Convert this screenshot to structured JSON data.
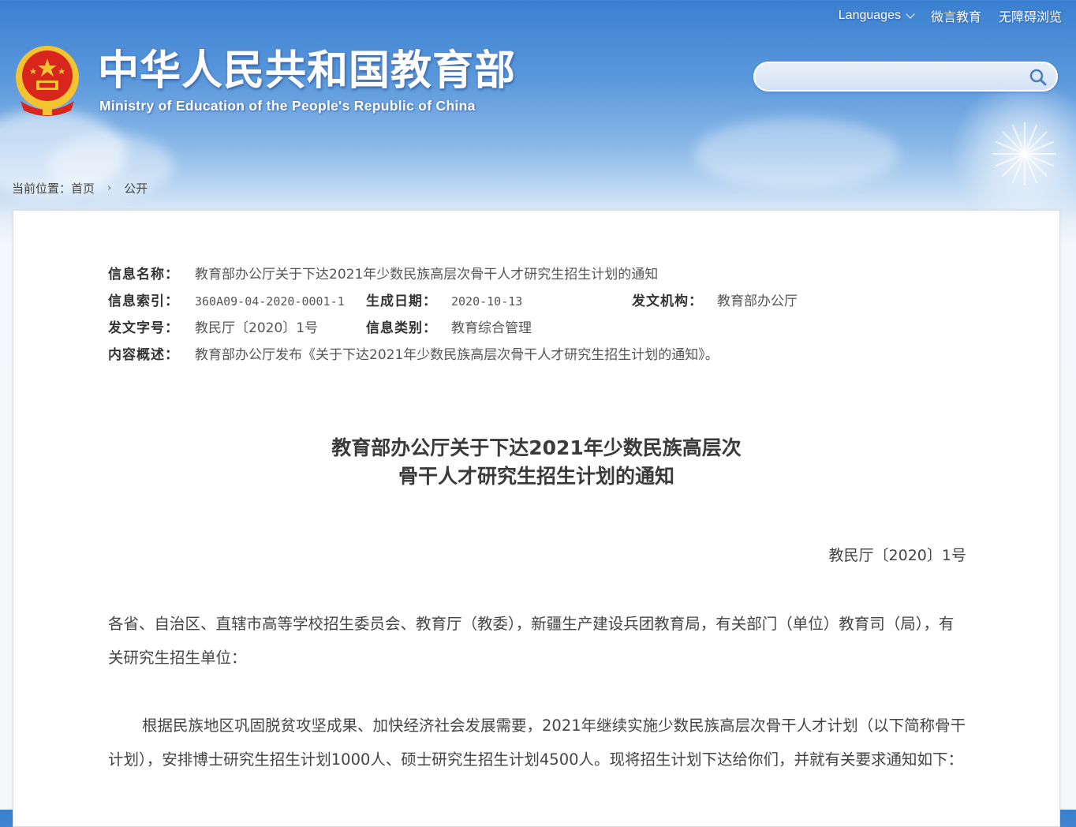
{
  "header": {
    "title": "中华人民共和国教育部",
    "subtitle": "Ministry of Education of the People's Republic of China",
    "top_links": [
      "Languages",
      "微言教育",
      "无障碍浏览"
    ],
    "search": {
      "placeholder": "",
      "value": ""
    }
  },
  "breadcrumb": {
    "prefix": "当前位置：",
    "items": [
      "首页",
      "公开"
    ]
  },
  "metadata": {
    "name_label": "信息名称：",
    "name_value": "教育部办公厅关于下达2021年少数民族高层次骨干人才研究生招生计划的通知",
    "index_label": "信息索引：",
    "index_value": "360A09-04-2020-0001-1",
    "date_label": "生成日期：",
    "date_value": "2020-10-13",
    "org_label": "发文机构：",
    "org_value": "教育部办公厅",
    "docno_label": "发文字号：",
    "docno_value": "教民厅〔2020〕1号",
    "category_label": "信息类别：",
    "category_value": "教育综合管理",
    "summary_label": "内容概述：",
    "summary_value": "教育部办公厅发布《关于下达2021年少数民族高层次骨干人才研究生招生计划的通知》。"
  },
  "document": {
    "title_line1": "教育部办公厅关于下达2021年少数民族高层次",
    "title_line2": "骨干人才研究生招生计划的通知",
    "number": "教民厅〔2020〕1号",
    "addressee": "各省、自治区、直辖市高等学校招生委员会、教育厅（教委），新疆生产建设兵团教育局，有关部门（单位）教育司（局），有关研究生招生单位：",
    "body_p1": "根据民族地区巩固脱贫攻坚成果、加快经济社会发展需要，2021年继续实施少数民族高层次骨干人才计划（以下简称骨干计划），安排博士研究生招生计划1000人、硕士研究生招生计划4500人。现将招生计划下达给你们，并就有关要求通知如下："
  },
  "colors": {
    "header_blue": "#3a7fd0",
    "emblem_red": "#d8261c",
    "emblem_gold": "#f4c430"
  }
}
